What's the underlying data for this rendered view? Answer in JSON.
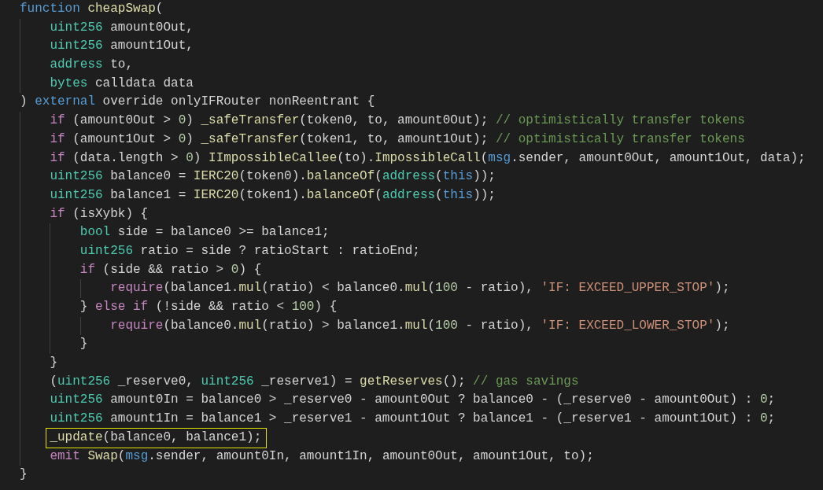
{
  "editor": {
    "lines": [
      {
        "highlighted": false,
        "tokens": [
          {
            "kind": "kw",
            "text": "function"
          },
          {
            "kind": "fn",
            "text": " cheapSwap"
          },
          {
            "kind": "plain",
            "text": "("
          }
        ],
        "children": [
          {
            "highlighted": false,
            "tokens": [
              {
                "kind": "type",
                "text": "uint256"
              },
              {
                "kind": "plain",
                "text": " amount0Out,"
              }
            ]
          },
          {
            "highlighted": false,
            "tokens": [
              {
                "kind": "type",
                "text": "uint256"
              },
              {
                "kind": "plain",
                "text": " amount1Out,"
              }
            ]
          },
          {
            "highlighted": false,
            "tokens": [
              {
                "kind": "type",
                "text": "address"
              },
              {
                "kind": "plain",
                "text": " to,"
              }
            ]
          },
          {
            "highlighted": false,
            "tokens": [
              {
                "kind": "type",
                "text": "bytes"
              },
              {
                "kind": "plain",
                "text": " calldata data"
              }
            ]
          }
        ]
      },
      {
        "highlighted": false,
        "tokens": [
          {
            "kind": "plain",
            "text": ") "
          },
          {
            "kind": "kw",
            "text": "external"
          },
          {
            "kind": "plain",
            "text": " override onlyIFRouter nonReentrant {"
          }
        ],
        "children": [
          {
            "highlighted": false,
            "tokens": [
              {
                "kind": "ctrl",
                "text": "if"
              },
              {
                "kind": "plain",
                "text": " (amount0Out > "
              },
              {
                "kind": "num",
                "text": "0"
              },
              {
                "kind": "plain",
                "text": ") "
              },
              {
                "kind": "fn",
                "text": "_safeTransfer"
              },
              {
                "kind": "plain",
                "text": "(token0, to, amount0Out); "
              },
              {
                "kind": "comment",
                "text": "// optimistically transfer tokens"
              }
            ]
          },
          {
            "highlighted": false,
            "tokens": [
              {
                "kind": "ctrl",
                "text": "if"
              },
              {
                "kind": "plain",
                "text": " (amount1Out > "
              },
              {
                "kind": "num",
                "text": "0"
              },
              {
                "kind": "plain",
                "text": ") "
              },
              {
                "kind": "fn",
                "text": "_safeTransfer"
              },
              {
                "kind": "plain",
                "text": "(token1, to, amount1Out); "
              },
              {
                "kind": "comment",
                "text": "// optimistically transfer tokens"
              }
            ]
          },
          {
            "highlighted": false,
            "tokens": [
              {
                "kind": "ctrl",
                "text": "if"
              },
              {
                "kind": "plain",
                "text": " (data.length > "
              },
              {
                "kind": "num",
                "text": "0"
              },
              {
                "kind": "plain",
                "text": ") "
              },
              {
                "kind": "fn",
                "text": "IImpossibleCallee"
              },
              {
                "kind": "plain",
                "text": "(to)."
              },
              {
                "kind": "fn",
                "text": "ImpossibleCall"
              },
              {
                "kind": "plain",
                "text": "("
              },
              {
                "kind": "kw",
                "text": "msg"
              },
              {
                "kind": "plain",
                "text": ".sender, amount0Out, amount1Out, data);"
              }
            ]
          },
          {
            "highlighted": false,
            "tokens": [
              {
                "kind": "type",
                "text": "uint256"
              },
              {
                "kind": "plain",
                "text": " balance0 = "
              },
              {
                "kind": "fn",
                "text": "IERC20"
              },
              {
                "kind": "plain",
                "text": "(token0)."
              },
              {
                "kind": "fn",
                "text": "balanceOf"
              },
              {
                "kind": "plain",
                "text": "("
              },
              {
                "kind": "type",
                "text": "address"
              },
              {
                "kind": "plain",
                "text": "("
              },
              {
                "kind": "kw",
                "text": "this"
              },
              {
                "kind": "plain",
                "text": "));"
              }
            ]
          },
          {
            "highlighted": false,
            "tokens": [
              {
                "kind": "type",
                "text": "uint256"
              },
              {
                "kind": "plain",
                "text": " balance1 = "
              },
              {
                "kind": "fn",
                "text": "IERC20"
              },
              {
                "kind": "plain",
                "text": "(token1)."
              },
              {
                "kind": "fn",
                "text": "balanceOf"
              },
              {
                "kind": "plain",
                "text": "("
              },
              {
                "kind": "type",
                "text": "address"
              },
              {
                "kind": "plain",
                "text": "("
              },
              {
                "kind": "kw",
                "text": "this"
              },
              {
                "kind": "plain",
                "text": "));"
              }
            ]
          },
          {
            "highlighted": false,
            "tokens": [
              {
                "kind": "ctrl",
                "text": "if"
              },
              {
                "kind": "plain",
                "text": " (isXybk) {"
              }
            ],
            "children": [
              {
                "highlighted": false,
                "tokens": [
                  {
                    "kind": "type",
                    "text": "bool"
                  },
                  {
                    "kind": "plain",
                    "text": " side = balance0 >= balance1;"
                  }
                ]
              },
              {
                "highlighted": false,
                "tokens": [
                  {
                    "kind": "type",
                    "text": "uint256"
                  },
                  {
                    "kind": "plain",
                    "text": " ratio = side ? ratioStart : ratioEnd;"
                  }
                ]
              },
              {
                "highlighted": false,
                "tokens": [
                  {
                    "kind": "ctrl",
                    "text": "if"
                  },
                  {
                    "kind": "plain",
                    "text": " (side && ratio > "
                  },
                  {
                    "kind": "num",
                    "text": "0"
                  },
                  {
                    "kind": "plain",
                    "text": ") {"
                  }
                ],
                "children": [
                  {
                    "highlighted": false,
                    "tokens": [
                      {
                        "kind": "ctrl",
                        "text": "require"
                      },
                      {
                        "kind": "plain",
                        "text": "(balance1."
                      },
                      {
                        "kind": "fn",
                        "text": "mul"
                      },
                      {
                        "kind": "plain",
                        "text": "(ratio) < balance0."
                      },
                      {
                        "kind": "fn",
                        "text": "mul"
                      },
                      {
                        "kind": "plain",
                        "text": "("
                      },
                      {
                        "kind": "num",
                        "text": "100"
                      },
                      {
                        "kind": "plain",
                        "text": " - ratio), "
                      },
                      {
                        "kind": "str",
                        "text": "'IF: EXCEED_UPPER_STOP'"
                      },
                      {
                        "kind": "plain",
                        "text": ");"
                      }
                    ]
                  }
                ]
              },
              {
                "highlighted": false,
                "tokens": [
                  {
                    "kind": "plain",
                    "text": "} "
                  },
                  {
                    "kind": "ctrl",
                    "text": "else if"
                  },
                  {
                    "kind": "plain",
                    "text": " (!side && ratio < "
                  },
                  {
                    "kind": "num",
                    "text": "100"
                  },
                  {
                    "kind": "plain",
                    "text": ") {"
                  }
                ],
                "children": [
                  {
                    "highlighted": false,
                    "tokens": [
                      {
                        "kind": "ctrl",
                        "text": "require"
                      },
                      {
                        "kind": "plain",
                        "text": "(balance0."
                      },
                      {
                        "kind": "fn",
                        "text": "mul"
                      },
                      {
                        "kind": "plain",
                        "text": "(ratio) > balance1."
                      },
                      {
                        "kind": "fn",
                        "text": "mul"
                      },
                      {
                        "kind": "plain",
                        "text": "("
                      },
                      {
                        "kind": "num",
                        "text": "100"
                      },
                      {
                        "kind": "plain",
                        "text": " - ratio), "
                      },
                      {
                        "kind": "str",
                        "text": "'IF: EXCEED_LOWER_STOP'"
                      },
                      {
                        "kind": "plain",
                        "text": ");"
                      }
                    ]
                  }
                ]
              },
              {
                "highlighted": false,
                "tokens": [
                  {
                    "kind": "plain",
                    "text": "}"
                  }
                ]
              }
            ]
          },
          {
            "highlighted": false,
            "tokens": [
              {
                "kind": "plain",
                "text": "}"
              }
            ]
          },
          {
            "highlighted": false,
            "tokens": [
              {
                "kind": "plain",
                "text": "("
              },
              {
                "kind": "type",
                "text": "uint256"
              },
              {
                "kind": "plain",
                "text": " _reserve0, "
              },
              {
                "kind": "type",
                "text": "uint256"
              },
              {
                "kind": "plain",
                "text": " _reserve1) = "
              },
              {
                "kind": "fn",
                "text": "getReserves"
              },
              {
                "kind": "plain",
                "text": "(); "
              },
              {
                "kind": "comment",
                "text": "// gas savings"
              }
            ]
          },
          {
            "highlighted": false,
            "tokens": [
              {
                "kind": "type",
                "text": "uint256"
              },
              {
                "kind": "plain",
                "text": " amount0In = balance0 > _reserve0 - amount0Out ? balance0 - (_reserve0 - amount0Out) : "
              },
              {
                "kind": "num",
                "text": "0"
              },
              {
                "kind": "plain",
                "text": ";"
              }
            ]
          },
          {
            "highlighted": false,
            "tokens": [
              {
                "kind": "type",
                "text": "uint256"
              },
              {
                "kind": "plain",
                "text": " amount1In = balance1 > _reserve1 - amount1Out ? balance1 - (_reserve1 - amount1Out) : "
              },
              {
                "kind": "num",
                "text": "0"
              },
              {
                "kind": "plain",
                "text": ";"
              }
            ]
          },
          {
            "highlighted": true,
            "tokens": [
              {
                "kind": "fn",
                "text": "_update"
              },
              {
                "kind": "plain",
                "text": "(balance0, balance1);"
              }
            ]
          },
          {
            "highlighted": false,
            "tokens": [
              {
                "kind": "ctrl",
                "text": "emit"
              },
              {
                "kind": "fn",
                "text": " Swap"
              },
              {
                "kind": "plain",
                "text": "("
              },
              {
                "kind": "kw",
                "text": "msg"
              },
              {
                "kind": "plain",
                "text": ".sender, amount0In, amount1In, amount0Out, amount1Out, to);"
              }
            ]
          }
        ]
      },
      {
        "highlighted": false,
        "tokens": [
          {
            "kind": "plain",
            "text": "}"
          }
        ]
      }
    ]
  }
}
